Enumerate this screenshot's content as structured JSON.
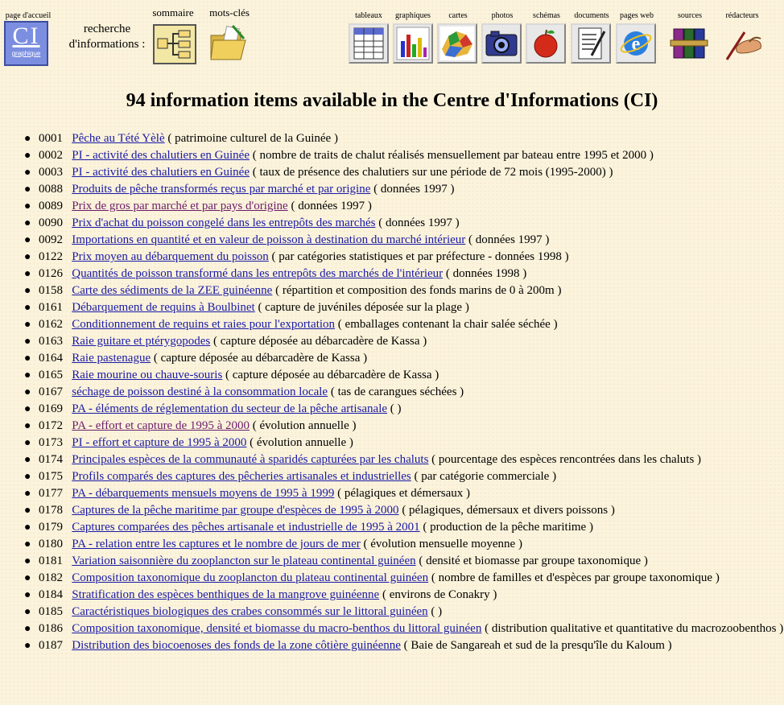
{
  "toolbar": {
    "home_label": "page d'accueil",
    "home_icon_text": "CI",
    "home_icon_subtext": "graphique",
    "search_label": "recherche d'informations :",
    "sommaire_label": "sommaire",
    "motscles_label": "mots-clés",
    "tableaux_label": "tableaux",
    "graphiques_label": "graphiques",
    "cartes_label": "cartes",
    "photos_label": "photos",
    "schemas_label": "schémas",
    "documents_label": "documents",
    "pagesweb_label": "pages web",
    "sources_label": "sources",
    "redacteurs_label": "rédacteurs"
  },
  "heading": "94 information items available in the Centre d'Informations (CI)",
  "items": [
    {
      "num": "0001",
      "title": "Pêche au Tété Yèlè",
      "desc": "( patrimoine culturel de la Guinée )"
    },
    {
      "num": "0002",
      "title": "PI - activité des chalutiers en Guinée",
      "desc": "( nombre de traits de chalut réalisés mensuellement par bateau entre 1995 et 2000 )"
    },
    {
      "num": "0003",
      "title": "PI - activité des chalutiers en Guinée",
      "desc": "( taux de présence des chalutiers sur une période de 72 mois (1995-2000) )"
    },
    {
      "num": "0088",
      "title": "Produits de pêche transformés reçus par marché et par origine",
      "desc": "( données 1997 )"
    },
    {
      "num": "0089",
      "title": "Prix de gros par marché et par pays d'origine",
      "desc": "( données 1997 )"
    },
    {
      "num": "0090",
      "title": "Prix d'achat du poisson congelé dans les entrepôts des marchés",
      "desc": "( données 1997 )"
    },
    {
      "num": "0092",
      "title": "Importations en quantité et en valeur de poisson à destination du marché intérieur",
      "desc": "( données 1997 )"
    },
    {
      "num": "0122",
      "title": "Prix moyen au débarquement du poisson",
      "desc": "( par catégories statistiques et par préfecture - données 1998 )"
    },
    {
      "num": "0126",
      "title": "Quantités de poisson transformé dans les entrepôts des marchés de l'intérieur",
      "desc": "( données 1998 )"
    },
    {
      "num": "0158",
      "title": "Carte des sédiments de la ZEE guinéenne",
      "desc": "( répartition et composition des fonds marins de 0 à 200m )"
    },
    {
      "num": "0161",
      "title": "Débarquement de requins à Boulbinet",
      "desc": "( capture de juvéniles déposée sur la plage )"
    },
    {
      "num": "0162",
      "title": "Conditionnement de requins et raies pour l'exportation",
      "desc": "( emballages contenant la chair salée séchée )"
    },
    {
      "num": "0163",
      "title": "Raie guitare et ptérygopodes",
      "desc": "( capture déposée au débarcadère de Kassa )"
    },
    {
      "num": "0164",
      "title": "Raie pastenague",
      "desc": "( capture déposée au débarcadère de Kassa )"
    },
    {
      "num": "0165",
      "title": "Raie mourine ou chauve-souris",
      "desc": "( capture déposée au débarcadère de Kassa )"
    },
    {
      "num": "0167",
      "title": "séchage de poisson destiné à la consommation locale",
      "desc": "( tas de carangues séchées )"
    },
    {
      "num": "0169",
      "title": "PA - éléments de réglementation du secteur de la pêche artisanale",
      "desc": "( )"
    },
    {
      "num": "0172",
      "title": "PA - effort et capture de 1995 à 2000",
      "desc": "( évolution annuelle )"
    },
    {
      "num": "0173",
      "title": "PI - effort et capture de 1995 à 2000",
      "desc": "( évolution annuelle )"
    },
    {
      "num": "0174",
      "title": "Principales espèces de la communauté à sparidés capturées par les chaluts",
      "desc": "( pourcentage des espèces rencontrées dans les chaluts )"
    },
    {
      "num": "0175",
      "title": "Profils comparés des captures des pêcheries artisanales et industrielles",
      "desc": "( par catégorie commerciale )"
    },
    {
      "num": "0177",
      "title": "PA - débarquements mensuels moyens de 1995 à 1999",
      "desc": "( pélagiques et démersaux )"
    },
    {
      "num": "0178",
      "title": "Captures de la pêche maritime par groupe d'espèces de 1995 à 2000",
      "desc": "( pélagiques, démersaux et divers poissons )"
    },
    {
      "num": "0179",
      "title": "Captures comparées des pêches artisanale et industrielle de 1995 à 2001",
      "desc": "( production de la pêche maritime )"
    },
    {
      "num": "0180",
      "title": "PA - relation entre les captures et le nombre de jours de mer",
      "desc": "( évolution mensuelle moyenne )"
    },
    {
      "num": "0181",
      "title": "Variation saisonnière du zooplancton sur le plateau continental guinéen",
      "desc": "( densité et biomasse par groupe taxonomique )"
    },
    {
      "num": "0182",
      "title": "Composition taxonomique du zooplancton du plateau continental guinéen",
      "desc": "( nombre de familles et d'espèces par groupe taxonomique )"
    },
    {
      "num": "0184",
      "title": "Stratification des espèces benthiques de la mangrove guinéenne",
      "desc": "( environs de Conakry )"
    },
    {
      "num": "0185",
      "title": "Caractéristiques biologiques des crabes consommés sur le littoral guinéen",
      "desc": "( )"
    },
    {
      "num": "0186",
      "title": "Composition taxonomique, densité et biomasse du macro-benthos du littoral guinéen",
      "desc": "( distribution qualitative et quantitative du macrozoobenthos )"
    },
    {
      "num": "0187",
      "title": "Distribution des biocoenoses des fonds de la zone côtière guinéenne",
      "desc": "( Baie de Sangareah et sud de la presqu'île du Kaloum )"
    }
  ]
}
